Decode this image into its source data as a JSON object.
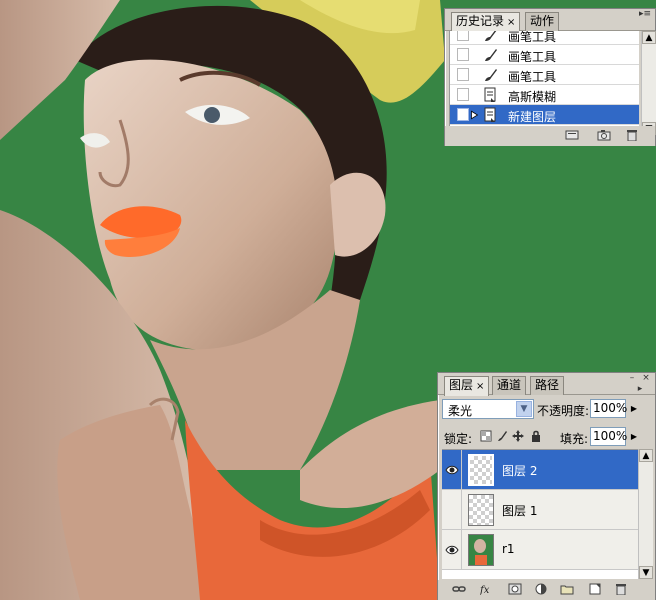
{
  "history_panel": {
    "tabs": [
      {
        "label": "历史记录",
        "close": "×"
      },
      {
        "label": "动作"
      }
    ],
    "items": [
      {
        "label": "画笔工具",
        "icon": "brush-icon"
      },
      {
        "label": "画笔工具",
        "icon": "brush-icon"
      },
      {
        "label": "画笔工具",
        "icon": "brush-icon"
      },
      {
        "label": "高斯模糊",
        "icon": "filter-doc-icon"
      },
      {
        "label": "新建图层",
        "icon": "new-layer-doc-icon",
        "selected": true
      }
    ],
    "bottom_icons": [
      "new-document-from-state-icon",
      "snapshot-camera-icon",
      "trash-icon"
    ]
  },
  "layers_panel": {
    "tabs": [
      {
        "label": "图层",
        "close": "×"
      },
      {
        "label": "通道"
      },
      {
        "label": "路径"
      }
    ],
    "blend_mode": "柔光",
    "opacity_label": "不透明度:",
    "opacity_value": "100%",
    "lock_label": "锁定:",
    "fill_label": "填充:",
    "fill_value": "100%",
    "layers": [
      {
        "name": "图层 2",
        "visible": true,
        "thumb": "transparent",
        "selected": true
      },
      {
        "name": "图层 1",
        "visible": false,
        "thumb": "transparent"
      },
      {
        "name": "r1",
        "visible": true,
        "thumb": "photo"
      }
    ],
    "bottom_icons": [
      "link-icon",
      "fx-icon",
      "mask-icon",
      "adjustment-icon",
      "group-folder-icon",
      "new-layer-icon",
      "trash-icon"
    ]
  },
  "colors": {
    "background_green": "#378544",
    "selection_blue": "#3169c6",
    "lip_orange": "#ff6a2a",
    "top_cloth_yellow": "#d6cc5a",
    "dress_orange": "#e8683a"
  }
}
